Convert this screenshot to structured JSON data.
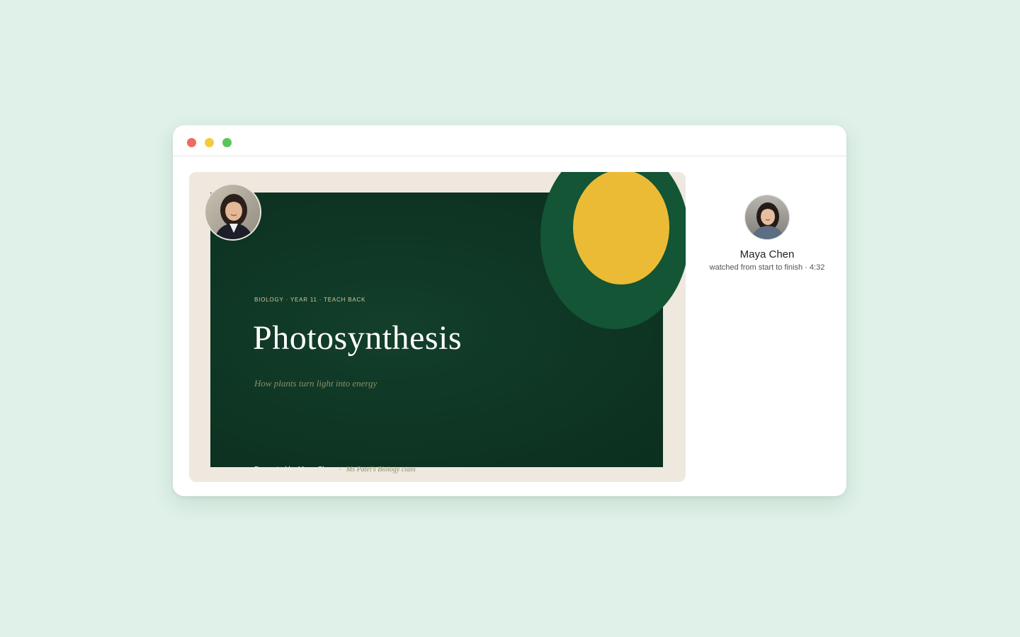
{
  "window": {
    "controls": [
      "close",
      "minimize",
      "maximize"
    ]
  },
  "slide": {
    "kicker": "BIOLOGY · YEAR 11 · TEACH BACK",
    "title": "Photosynthesis",
    "subtitle": "How plants turn light into energy",
    "presenter_prefix": "Presented by",
    "presenter_name": "Maya Chen",
    "separator": "·",
    "class_name": "Ms Patel's Biology class",
    "colors": {
      "background": "#0e3322",
      "accent_green": "#135534",
      "accent_yellow": "#ecbb35"
    }
  },
  "presenter_cam": {
    "icon": "presenter-avatar-photo"
  },
  "viewer": {
    "name": "Maya Chen",
    "status": "watched from start to finish",
    "separator": "·",
    "duration": "4:32",
    "icon": "viewer-avatar-photo"
  },
  "colors": {
    "page_bg": "#dff1e8",
    "window_bg": "#ffffff",
    "stage_bg": "#efe8df"
  }
}
